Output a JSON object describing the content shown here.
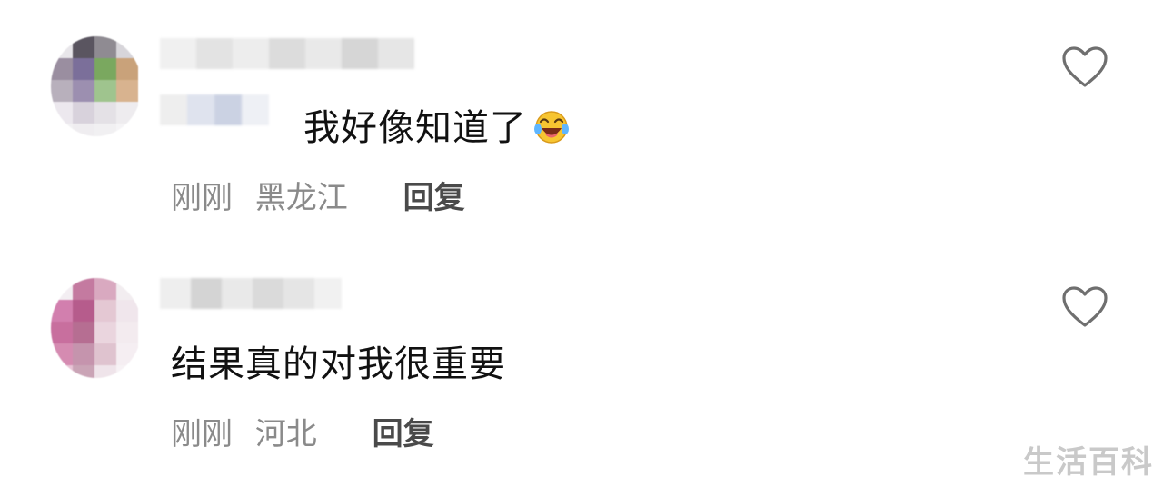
{
  "comments": [
    {
      "text": "我好像知道了",
      "emoji": "laughing-tears-emoji",
      "time": "刚刚",
      "location": "黑龙江",
      "reply_label": "回复",
      "username_blurred": true
    },
    {
      "text": "结果真的对我很重要",
      "time": "刚刚",
      "location": "河北",
      "reply_label": "回复",
      "username_blurred": true
    }
  ],
  "icons": {
    "like": "heart-outline-icon",
    "emoji": "laughing-tears-emoji"
  },
  "colors": {
    "background": "#ffffff",
    "text": "#111111",
    "meta": "#8a8a8a",
    "reply": "#4a4a4a",
    "watermark": "#c9c9c9"
  },
  "watermark": "生活百科"
}
